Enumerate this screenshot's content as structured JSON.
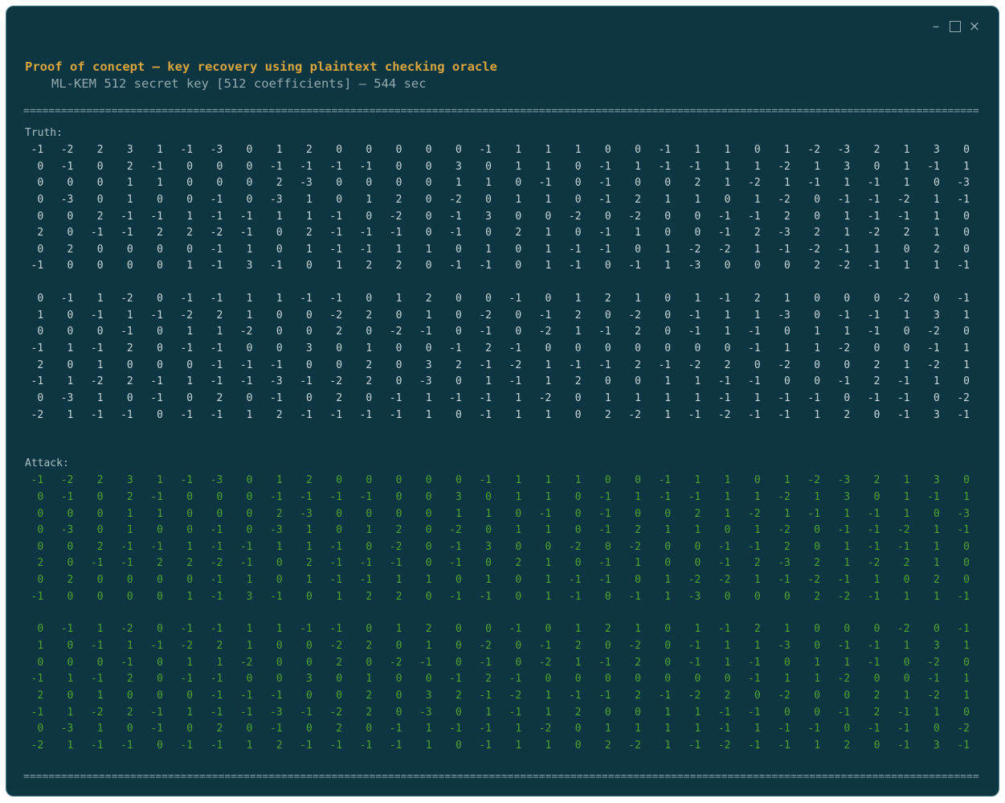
{
  "window": {
    "controls": {
      "minimize_glyph": "–",
      "close_glyph": "×"
    }
  },
  "header": {
    "title": "Proof of concept – key recovery using plaintext checking oracle",
    "subtitle": "ML-KEM 512 secret key [512 coefficients] – 544 sec"
  },
  "separator": {
    "char": "=",
    "count": 152
  },
  "sections": {
    "truth": {
      "label": "Truth:",
      "blocks": [
        [
          [
            -1,
            -2,
            2,
            3,
            1,
            -1,
            -3,
            0,
            1,
            2,
            0,
            0,
            0,
            0,
            0,
            -1,
            1,
            1,
            1,
            0,
            0,
            -1,
            1,
            1,
            0,
            1,
            -2,
            -3,
            2,
            1,
            3,
            0
          ],
          [
            0,
            -1,
            0,
            2,
            -1,
            0,
            0,
            0,
            -1,
            -1,
            -1,
            -1,
            0,
            0,
            3,
            0,
            1,
            1,
            0,
            -1,
            1,
            -1,
            -1,
            1,
            1,
            -2,
            1,
            3,
            0,
            1,
            -1,
            1
          ],
          [
            0,
            0,
            0,
            1,
            1,
            0,
            0,
            0,
            2,
            -3,
            0,
            0,
            0,
            0,
            1,
            1,
            0,
            -1,
            0,
            -1,
            0,
            0,
            2,
            1,
            -2,
            1,
            -1,
            1,
            -1,
            1,
            0,
            -3
          ],
          [
            0,
            -3,
            0,
            1,
            0,
            0,
            -1,
            0,
            -3,
            1,
            0,
            1,
            2,
            0,
            -2,
            0,
            1,
            1,
            0,
            -1,
            2,
            1,
            1,
            0,
            1,
            -2,
            0,
            -1,
            -1,
            -2,
            1,
            -1
          ],
          [
            0,
            0,
            2,
            -1,
            -1,
            1,
            -1,
            -1,
            1,
            1,
            -1,
            0,
            -2,
            0,
            -1,
            3,
            0,
            0,
            -2,
            0,
            -2,
            0,
            0,
            -1,
            -1,
            2,
            0,
            1,
            -1,
            -1,
            1,
            0
          ],
          [
            2,
            0,
            -1,
            -1,
            2,
            2,
            -2,
            -1,
            0,
            2,
            -1,
            -1,
            -1,
            0,
            -1,
            0,
            2,
            1,
            0,
            -1,
            1,
            0,
            0,
            -1,
            2,
            -3,
            2,
            1,
            -2,
            2,
            1,
            0
          ],
          [
            0,
            2,
            0,
            0,
            0,
            0,
            -1,
            1,
            0,
            1,
            -1,
            -1,
            1,
            1,
            0,
            1,
            0,
            1,
            -1,
            -1,
            0,
            1,
            -2,
            -2,
            1,
            -1,
            -2,
            -1,
            1,
            0,
            2,
            0
          ],
          [
            -1,
            0,
            0,
            0,
            0,
            1,
            -1,
            3,
            -1,
            0,
            1,
            2,
            2,
            0,
            -1,
            -1,
            0,
            1,
            -1,
            0,
            -1,
            1,
            -3,
            0,
            0,
            0,
            2,
            -2,
            -1,
            1,
            1,
            -1
          ]
        ],
        [
          [
            0,
            -1,
            1,
            -2,
            0,
            -1,
            -1,
            1,
            1,
            -1,
            -1,
            0,
            1,
            2,
            0,
            0,
            -1,
            0,
            1,
            2,
            1,
            0,
            1,
            -1,
            2,
            1,
            0,
            0,
            0,
            -2,
            0,
            -1
          ],
          [
            1,
            0,
            -1,
            1,
            -1,
            -2,
            2,
            1,
            0,
            0,
            -2,
            2,
            0,
            1,
            0,
            -2,
            0,
            -1,
            2,
            0,
            -2,
            0,
            -1,
            1,
            1,
            -3,
            0,
            -1,
            -1,
            1,
            3,
            1
          ],
          [
            0,
            0,
            0,
            -1,
            0,
            1,
            1,
            -2,
            0,
            0,
            2,
            0,
            -2,
            -1,
            0,
            -1,
            0,
            -2,
            1,
            -1,
            2,
            0,
            -1,
            1,
            -1,
            0,
            1,
            1,
            -1,
            0,
            -2,
            0
          ],
          [
            -1,
            1,
            -1,
            2,
            0,
            -1,
            -1,
            0,
            0,
            3,
            0,
            1,
            0,
            0,
            -1,
            2,
            -1,
            0,
            0,
            0,
            0,
            0,
            0,
            0,
            -1,
            1,
            1,
            -2,
            0,
            0,
            -1,
            1
          ],
          [
            2,
            0,
            1,
            0,
            0,
            0,
            -1,
            -1,
            -1,
            0,
            0,
            2,
            0,
            3,
            2,
            -1,
            -2,
            1,
            -1,
            -1,
            2,
            -1,
            -2,
            2,
            0,
            -2,
            0,
            0,
            2,
            1,
            -2,
            1
          ],
          [
            -1,
            1,
            -2,
            2,
            -1,
            1,
            -1,
            -1,
            -3,
            -1,
            -2,
            2,
            0,
            -3,
            0,
            1,
            -1,
            1,
            2,
            0,
            0,
            1,
            1,
            -1,
            -1,
            0,
            0,
            -1,
            2,
            -1,
            1,
            0
          ],
          [
            0,
            -3,
            1,
            0,
            -1,
            0,
            2,
            0,
            -1,
            0,
            2,
            0,
            -1,
            1,
            -1,
            -1,
            1,
            -2,
            0,
            1,
            1,
            1,
            1,
            -1,
            1,
            -1,
            -1,
            0,
            -1,
            -1,
            0,
            -2
          ],
          [
            -2,
            1,
            -1,
            -1,
            0,
            -1,
            -1,
            1,
            2,
            -1,
            -1,
            -1,
            -1,
            1,
            0,
            -1,
            1,
            1,
            0,
            2,
            -2,
            1,
            -1,
            -2,
            -1,
            -1,
            1,
            2,
            0,
            -1,
            3,
            -1
          ]
        ]
      ]
    },
    "attack": {
      "label": "Attack:",
      "blocks": [
        [
          [
            -1,
            -2,
            2,
            3,
            1,
            -1,
            -3,
            0,
            1,
            2,
            0,
            0,
            0,
            0,
            0,
            -1,
            1,
            1,
            1,
            0,
            0,
            -1,
            1,
            1,
            0,
            1,
            -2,
            -3,
            2,
            1,
            3,
            0
          ],
          [
            0,
            -1,
            0,
            2,
            -1,
            0,
            0,
            0,
            -1,
            -1,
            -1,
            -1,
            0,
            0,
            3,
            0,
            1,
            1,
            0,
            -1,
            1,
            -1,
            -1,
            1,
            1,
            -2,
            1,
            3,
            0,
            1,
            -1,
            1
          ],
          [
            0,
            0,
            0,
            1,
            1,
            0,
            0,
            0,
            2,
            -3,
            0,
            0,
            0,
            0,
            1,
            1,
            0,
            -1,
            0,
            -1,
            0,
            0,
            2,
            1,
            -2,
            1,
            -1,
            1,
            -1,
            1,
            0,
            -3
          ],
          [
            0,
            -3,
            0,
            1,
            0,
            0,
            -1,
            0,
            -3,
            1,
            0,
            1,
            2,
            0,
            -2,
            0,
            1,
            1,
            0,
            -1,
            2,
            1,
            1,
            0,
            1,
            -2,
            0,
            -1,
            -1,
            -2,
            1,
            -1
          ],
          [
            0,
            0,
            2,
            -1,
            -1,
            1,
            -1,
            -1,
            1,
            1,
            -1,
            0,
            -2,
            0,
            -1,
            3,
            0,
            0,
            -2,
            0,
            -2,
            0,
            0,
            -1,
            -1,
            2,
            0,
            1,
            -1,
            -1,
            1,
            0
          ],
          [
            2,
            0,
            -1,
            -1,
            2,
            2,
            -2,
            -1,
            0,
            2,
            -1,
            -1,
            -1,
            0,
            -1,
            0,
            2,
            1,
            0,
            -1,
            1,
            0,
            0,
            -1,
            2,
            -3,
            2,
            1,
            -2,
            2,
            1,
            0
          ],
          [
            0,
            2,
            0,
            0,
            0,
            0,
            -1,
            1,
            0,
            1,
            -1,
            -1,
            1,
            1,
            0,
            1,
            0,
            1,
            -1,
            -1,
            0,
            1,
            -2,
            -2,
            1,
            -1,
            -2,
            -1,
            1,
            0,
            2,
            0
          ],
          [
            -1,
            0,
            0,
            0,
            0,
            1,
            -1,
            3,
            -1,
            0,
            1,
            2,
            2,
            0,
            -1,
            -1,
            0,
            1,
            -1,
            0,
            -1,
            1,
            -3,
            0,
            0,
            0,
            2,
            -2,
            -1,
            1,
            1,
            -1
          ]
        ],
        [
          [
            0,
            -1,
            1,
            -2,
            0,
            -1,
            -1,
            1,
            1,
            -1,
            -1,
            0,
            1,
            2,
            0,
            0,
            -1,
            0,
            1,
            2,
            1,
            0,
            1,
            -1,
            2,
            1,
            0,
            0,
            0,
            -2,
            0,
            -1
          ],
          [
            1,
            0,
            -1,
            1,
            -1,
            -2,
            2,
            1,
            0,
            0,
            -2,
            2,
            0,
            1,
            0,
            -2,
            0,
            -1,
            2,
            0,
            -2,
            0,
            -1,
            1,
            1,
            -3,
            0,
            -1,
            -1,
            1,
            3,
            1
          ],
          [
            0,
            0,
            0,
            -1,
            0,
            1,
            1,
            -2,
            0,
            0,
            2,
            0,
            -2,
            -1,
            0,
            -1,
            0,
            -2,
            1,
            -1,
            2,
            0,
            -1,
            1,
            -1,
            0,
            1,
            1,
            -1,
            0,
            -2,
            0
          ],
          [
            -1,
            1,
            -1,
            2,
            0,
            -1,
            -1,
            0,
            0,
            3,
            0,
            1,
            0,
            0,
            -1,
            2,
            -1,
            0,
            0,
            0,
            0,
            0,
            0,
            0,
            -1,
            1,
            1,
            -2,
            0,
            0,
            -1,
            1
          ],
          [
            2,
            0,
            1,
            0,
            0,
            0,
            -1,
            -1,
            -1,
            0,
            0,
            2,
            0,
            3,
            2,
            -1,
            -2,
            1,
            -1,
            -1,
            2,
            -1,
            -2,
            2,
            0,
            -2,
            0,
            0,
            2,
            1,
            -2,
            1
          ],
          [
            -1,
            1,
            -2,
            2,
            -1,
            1,
            -1,
            -1,
            -3,
            -1,
            -2,
            2,
            0,
            -3,
            0,
            1,
            -1,
            1,
            2,
            0,
            0,
            1,
            1,
            -1,
            -1,
            0,
            0,
            -1,
            2,
            -1,
            1,
            0
          ],
          [
            0,
            -3,
            1,
            0,
            -1,
            0,
            2,
            0,
            -1,
            0,
            2,
            0,
            -1,
            1,
            -1,
            -1,
            1,
            -2,
            0,
            1,
            1,
            1,
            1,
            -1,
            1,
            -1,
            -1,
            0,
            -1,
            -1,
            0,
            -2
          ],
          [
            -2,
            1,
            -1,
            -1,
            0,
            -1,
            -1,
            1,
            2,
            -1,
            -1,
            -1,
            -1,
            1,
            0,
            -1,
            1,
            1,
            0,
            2,
            -2,
            1,
            -1,
            -2,
            -1,
            -1,
            1,
            2,
            0,
            -1,
            3,
            -1
          ]
        ]
      ]
    }
  },
  "colors": {
    "page_background": "#ffffff",
    "window_background": "#0d3642",
    "window_border": "#4e7a86",
    "title": "#d9a43b",
    "subtitle": "#93a9ad",
    "section_label": "#aebfc3",
    "truth_values": "#c9d6d8",
    "attack_values": "#52a12e",
    "separator": "#8299a0",
    "window_controls": "#97acb1"
  }
}
